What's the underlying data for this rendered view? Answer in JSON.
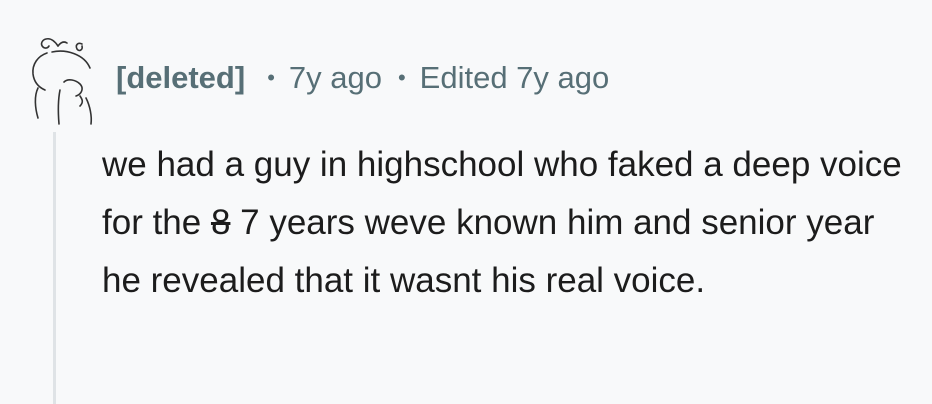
{
  "comment": {
    "author": "[deleted]",
    "age": "7y ago",
    "edited": "Edited 7y ago",
    "separator": "•",
    "body": {
      "before": "we had a guy in highschool who faked a deep voice for the ",
      "struck": "8",
      "after": " 7 years weve known him and senior year he revealed that it wasnt his real voice."
    }
  },
  "icons": {
    "avatar": "deleted-user-snoo-avatar"
  },
  "colors": {
    "background": "#f8f9fa",
    "meta_text": "#576f76",
    "body_text": "#1c1c1c",
    "thread_line": "#dfe3e6"
  }
}
